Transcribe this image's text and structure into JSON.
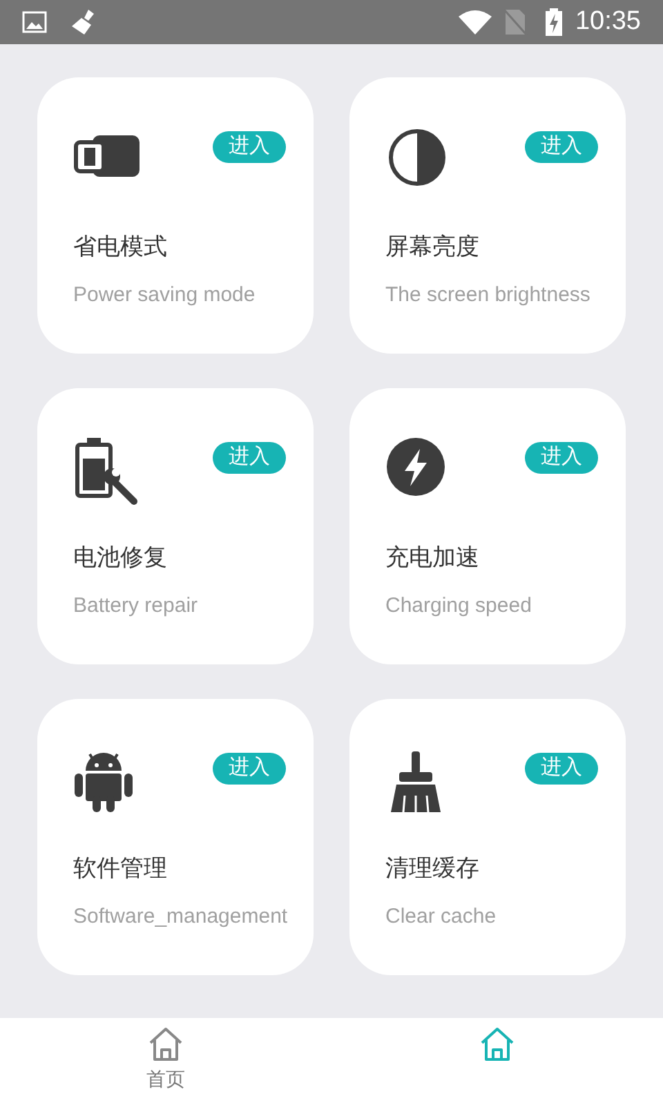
{
  "status_bar": {
    "time": "10:35"
  },
  "cards": [
    {
      "kind": "power",
      "title": "省电模式",
      "subtitle": "Power saving mode",
      "button": "进入"
    },
    {
      "kind": "brightness",
      "title": "屏幕亮度",
      "subtitle": "The screen brightness",
      "button": "进入"
    },
    {
      "kind": "repair",
      "title": "电池修复",
      "subtitle": "Battery repair",
      "button": "进入"
    },
    {
      "kind": "charge",
      "title": "充电加速",
      "subtitle": "Charging speed",
      "button": "进入"
    },
    {
      "kind": "android",
      "title": "软件管理",
      "subtitle": "Software_management",
      "button": "进入"
    },
    {
      "kind": "broom",
      "title": "清理缓存",
      "subtitle": "Clear cache",
      "button": "进入"
    }
  ],
  "bottom_nav": [
    {
      "label": "首页",
      "selected": false
    },
    {
      "selected": true
    }
  ]
}
